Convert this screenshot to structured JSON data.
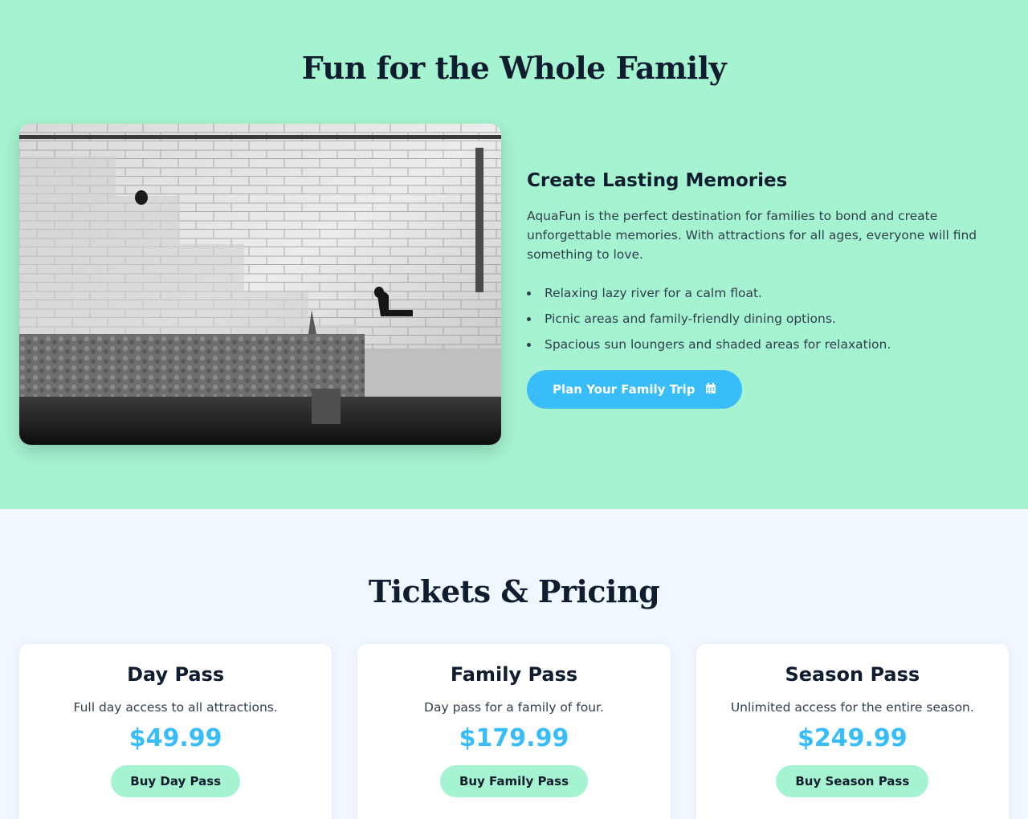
{
  "family_section": {
    "title": "Fun for the Whole Family",
    "heading": "Create Lasting Memories",
    "description": "AquaFun is the perfect destination for families to bond and create unforgettable memories. With attractions for all ages, everyone will find something to love.",
    "features": [
      "Relaxing lazy river for a calm float.",
      "Picnic areas and family-friendly dining options.",
      "Spacious sun loungers and shaded areas for relaxation."
    ],
    "cta_label": "Plan Your Family Trip",
    "cta_icon": "calendar-icon",
    "image_description": "black and white photo of stone river steps with two seated people"
  },
  "pricing_section": {
    "title": "Tickets & Pricing",
    "plans": [
      {
        "name": "Day Pass",
        "description": "Full day access to all attractions.",
        "price": "$49.99",
        "button_label": "Buy Day Pass"
      },
      {
        "name": "Family Pass",
        "description": "Day pass for a family of four.",
        "price": "$179.99",
        "button_label": "Buy Family Pass"
      },
      {
        "name": "Season Pass",
        "description": "Unlimited access for the entire season.",
        "price": "$249.99",
        "button_label": "Buy Season Pass"
      }
    ]
  },
  "colors": {
    "mint": "#a6f3d1",
    "sky": "#38bdf8",
    "navy": "#0f1d2e",
    "pricing_bg": "#f0f7ff"
  }
}
